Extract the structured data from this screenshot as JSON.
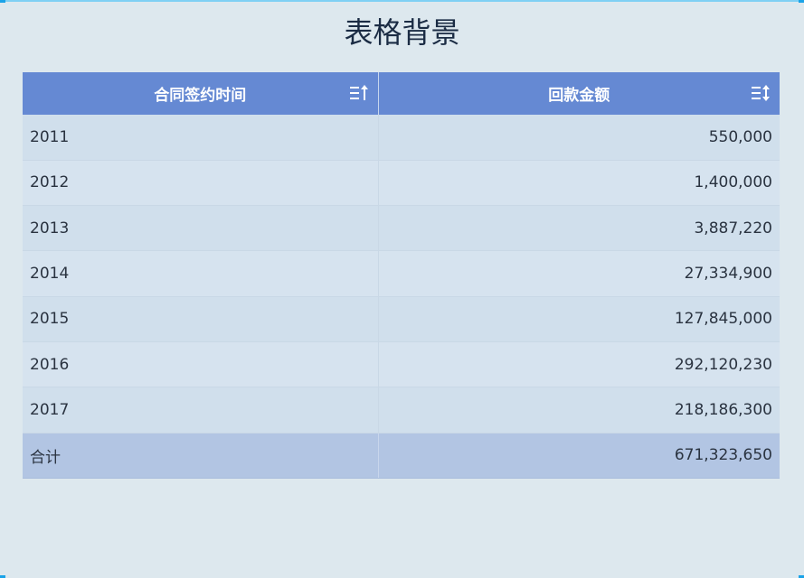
{
  "page": {
    "title": "表格背景"
  },
  "table": {
    "columns": [
      {
        "label": "合同签约时间",
        "sort_icon": "sort-ascending-icon"
      },
      {
        "label": "回款金额",
        "sort_icon": "sort-both-icon"
      }
    ],
    "rows": [
      {
        "year": "2011",
        "amount": "550,000"
      },
      {
        "year": "2012",
        "amount": "1,400,000"
      },
      {
        "year": "2013",
        "amount": "3,887,220"
      },
      {
        "year": "2014",
        "amount": "27,334,900"
      },
      {
        "year": "2015",
        "amount": "127,845,000"
      },
      {
        "year": "2016",
        "amount": "292,120,230"
      },
      {
        "year": "2017",
        "amount": "218,186,300"
      }
    ],
    "total": {
      "label": "合计",
      "amount": "671,323,650"
    }
  },
  "colors": {
    "background": "#dde8ee",
    "header": "#6589d3",
    "row_odd": "#d0dfec",
    "row_even": "#d6e3ef",
    "total_row": "#b2c5e3",
    "accent": "#1aa3e8"
  }
}
